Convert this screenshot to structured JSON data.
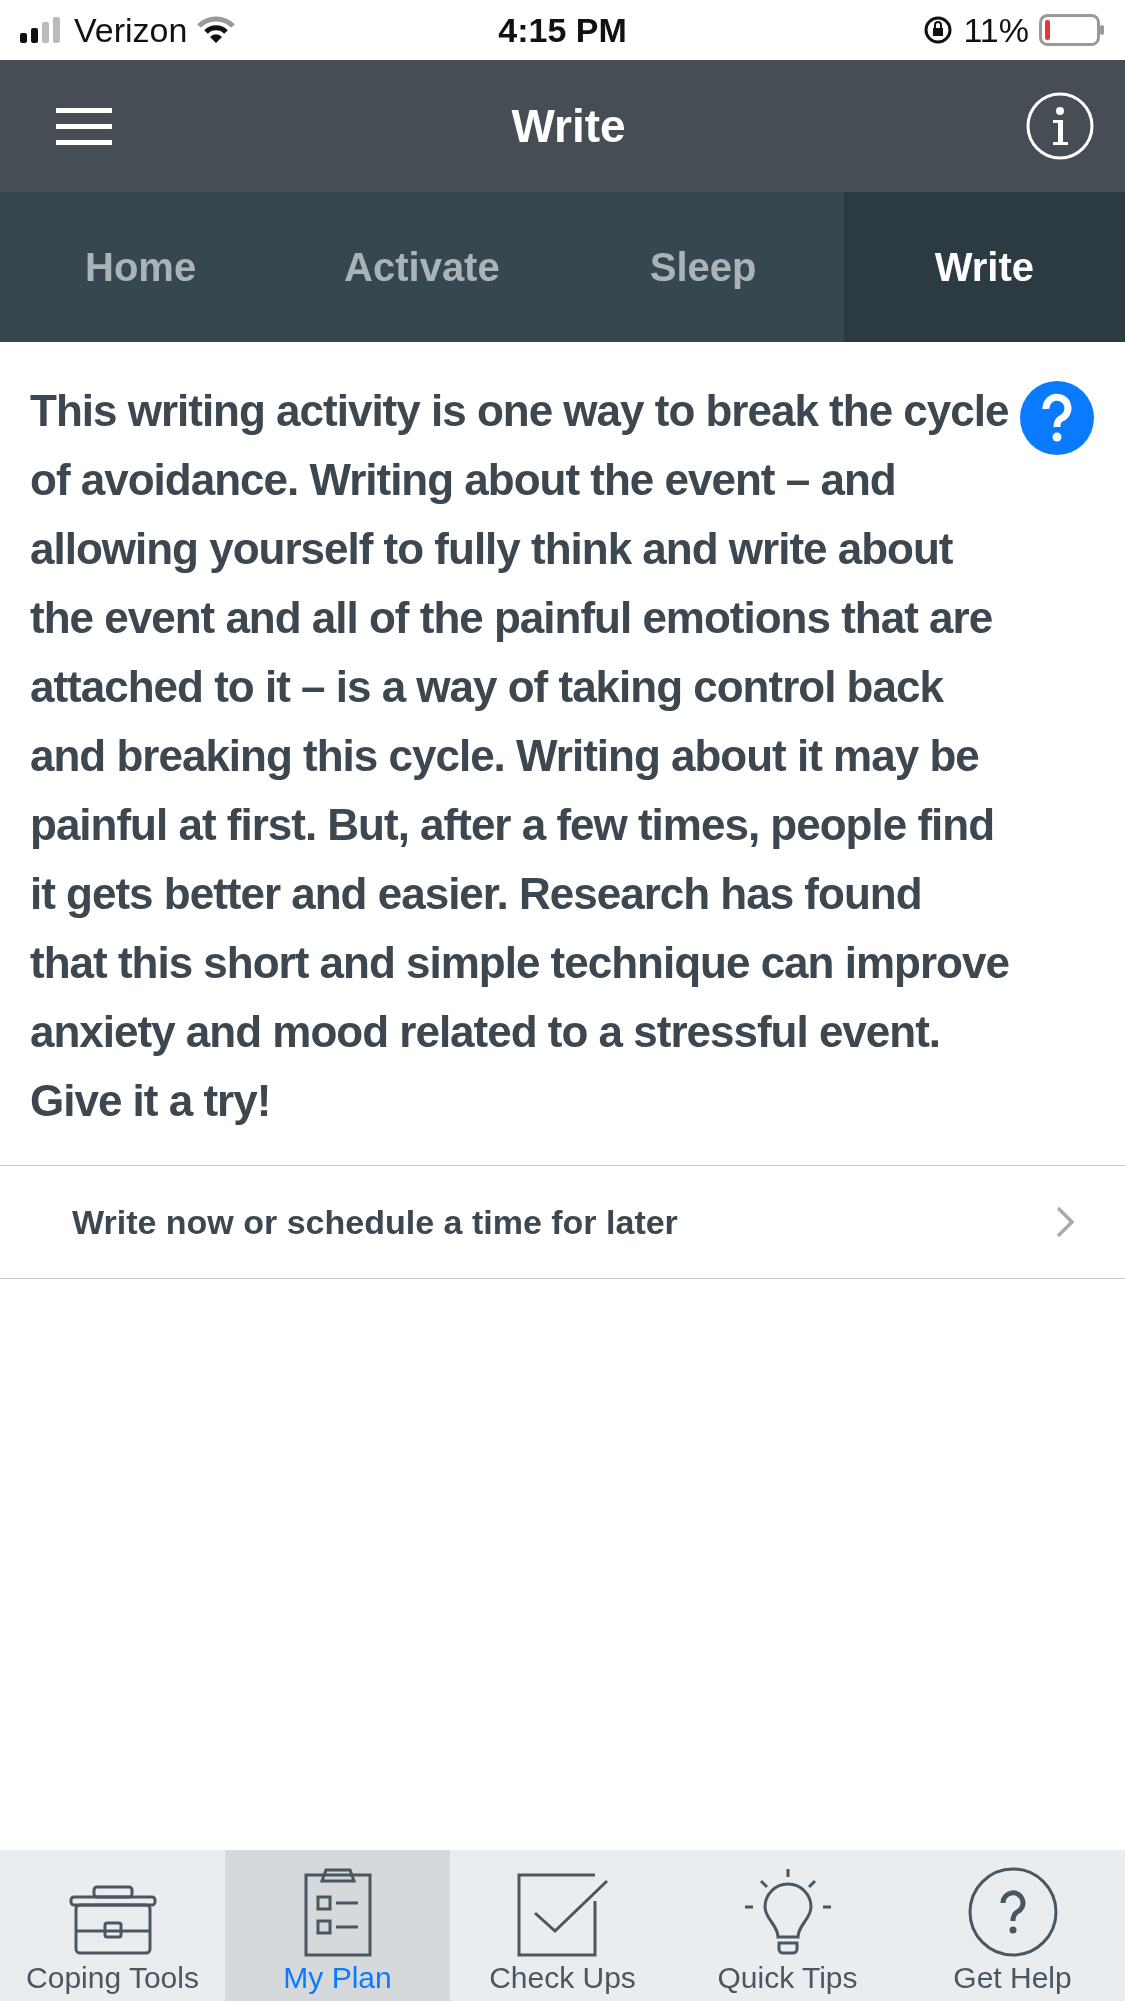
{
  "status_bar": {
    "carrier": "Verizon",
    "time": "4:15 PM",
    "battery": "11%"
  },
  "header": {
    "title": "Write"
  },
  "tabs": [
    {
      "label": "Home",
      "selected": false
    },
    {
      "label": "Activate",
      "selected": false
    },
    {
      "label": "Sleep",
      "selected": false
    },
    {
      "label": "Write",
      "selected": true
    }
  ],
  "intro": {
    "text": "This writing activity is one way to break the cycle of avoidance. Writing about the event – and allowing yourself to fully think and write about the event and all of the painful emotions that are attached to it – is a way of taking control back and breaking this cycle. Writing about it may be painful at first. But, after a few times, people find it gets better and easier. Research has found that this short and simple technique can improve anxiety and mood related to a stressful event. Give it a try!"
  },
  "action_row": {
    "label": "Write now or schedule a time for later"
  },
  "tab_bar": [
    {
      "label": "Coping Tools",
      "selected": false
    },
    {
      "label": "My Plan",
      "selected": true
    },
    {
      "label": "Check Ups",
      "selected": false
    },
    {
      "label": "Quick Tips",
      "selected": false
    },
    {
      "label": "Get Help",
      "selected": false
    }
  ]
}
